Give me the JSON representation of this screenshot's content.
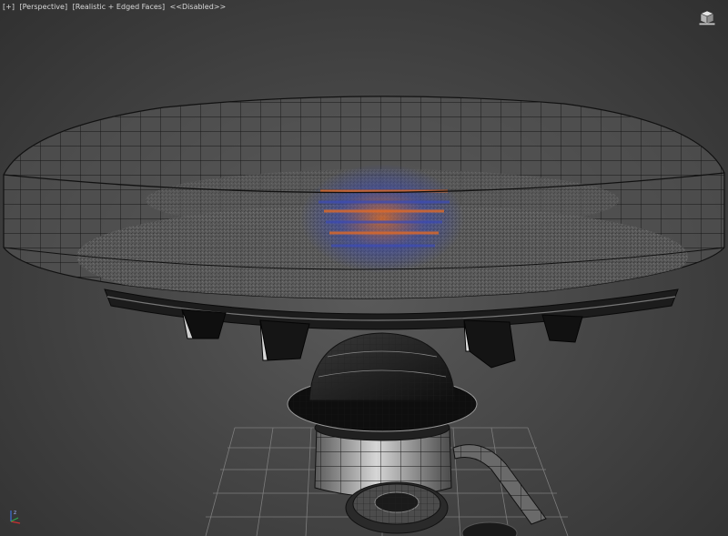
{
  "viewport": {
    "labels": {
      "plus": "[+]",
      "view": "[Perspective]",
      "shading": "[Realistic + Edged Faces]",
      "state": "<<Disabled>>"
    },
    "axis_label": "z"
  },
  "icons": {
    "viewcube": "viewcube-icon",
    "axis_gizmo": "axis-tripod-icon"
  },
  "colors": {
    "background": "#3a3a3a",
    "grid": "#7a7a7a",
    "wire": "#0c0c0c",
    "mesh": "#6e6e6e",
    "glow_orange": "#e06a28",
    "glow_blue": "#3a4ab8"
  }
}
